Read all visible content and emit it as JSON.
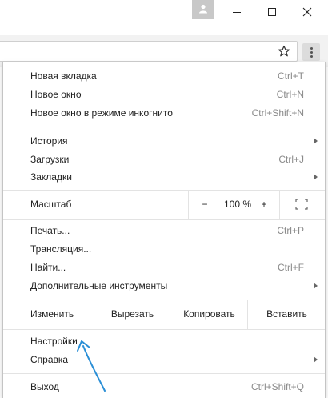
{
  "window": {
    "profile_icon": "person-icon",
    "minimize_icon": "minimize-icon",
    "maximize_icon": "maximize-icon",
    "close_icon": "close-icon"
  },
  "toolbar": {
    "bookmark_icon": "star-icon",
    "menu_icon": "three-dots-icon"
  },
  "menu": {
    "items_top": [
      {
        "label": "Новая вкладка",
        "shortcut": "Ctrl+T"
      },
      {
        "label": "Новое окно",
        "shortcut": "Ctrl+N"
      },
      {
        "label": "Новое окно в режиме инкогнито",
        "shortcut": "Ctrl+Shift+N"
      }
    ],
    "history": {
      "label": "История"
    },
    "downloads": {
      "label": "Загрузки",
      "shortcut": "Ctrl+J"
    },
    "bookmarks": {
      "label": "Закладки"
    },
    "zoom": {
      "label": "Масштаб",
      "minus": "−",
      "value": "100 %",
      "plus": "+",
      "fullscreen_icon": "fullscreen-icon"
    },
    "print": {
      "label": "Печать...",
      "shortcut": "Ctrl+P"
    },
    "cast": {
      "label": "Трансляция..."
    },
    "find": {
      "label": "Найти...",
      "shortcut": "Ctrl+F"
    },
    "more_tools": {
      "label": "Дополнительные инструменты"
    },
    "edit": {
      "label": "Изменить",
      "cut": "Вырезать",
      "copy": "Копировать",
      "paste": "Вставить"
    },
    "settings": {
      "label": "Настройки"
    },
    "help": {
      "label": "Справка"
    },
    "exit": {
      "label": "Выход",
      "shortcut": "Ctrl+Shift+Q"
    }
  },
  "colors": {
    "annotation_arrow": "#2b8fd6"
  }
}
